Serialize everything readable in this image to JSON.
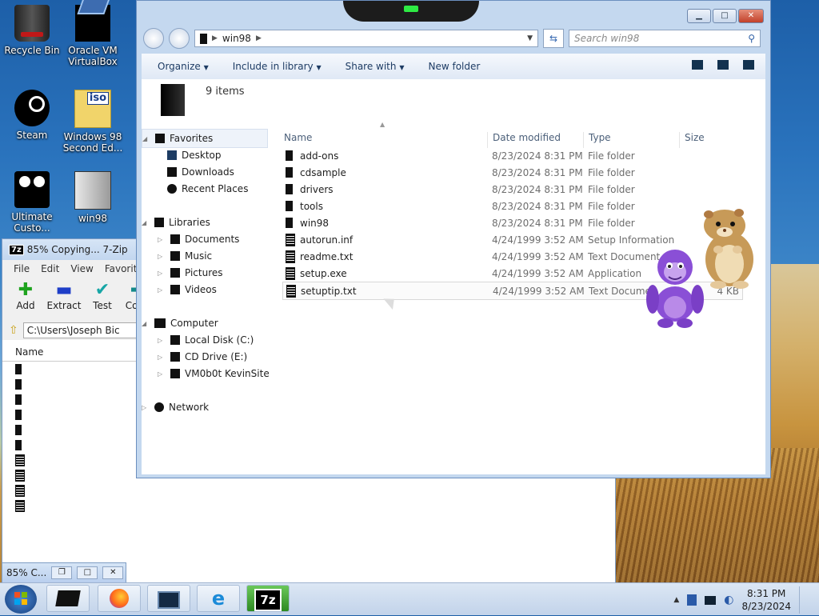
{
  "desktop": {
    "icons": [
      {
        "label": "Recycle Bin",
        "icon": "recycle-bin-icon"
      },
      {
        "label": "Oracle VM VirtualBox",
        "icon": "virtualbox-icon"
      },
      {
        "label": "Steam",
        "icon": "steam-icon"
      },
      {
        "label": "Windows 98 Second Ed...",
        "icon": "iso-file-icon"
      },
      {
        "label": "Ultimate Custo...",
        "icon": "film-reel-icon"
      },
      {
        "label": "win98",
        "icon": "document-icon"
      }
    ]
  },
  "zip": {
    "title": "85% Copying... 7-Zip",
    "menu": [
      "File",
      "Edit",
      "View",
      "Favorites"
    ],
    "tools": [
      "Add",
      "Extract",
      "Test",
      "Copy"
    ],
    "path": "C:\\Users\\Joseph Bic",
    "column_name": "Name",
    "progress_title": "85% C..."
  },
  "explorer": {
    "address": [
      "win98"
    ],
    "search_placeholder": "Search win98",
    "commands": [
      "Organize",
      "Include in library",
      "Share with",
      "New folder"
    ],
    "item_count": "9 items",
    "nav": {
      "favorites": "Favorites",
      "desktop": "Desktop",
      "downloads": "Downloads",
      "recent": "Recent Places",
      "libraries": "Libraries",
      "documents": "Documents",
      "music": "Music",
      "pictures": "Pictures",
      "videos": "Videos",
      "computer": "Computer",
      "local_disk": "Local Disk (C:)",
      "cd_drive": "CD Drive (E:)",
      "vm_drive": "VM0b0t KevinSite",
      "network": "Network"
    },
    "columns": {
      "name": "Name",
      "date": "Date modified",
      "type": "Type",
      "size": "Size"
    },
    "files": [
      {
        "name": "add-ons",
        "date": "8/23/2024 8:31 PM",
        "type": "File folder",
        "size": "",
        "kind": "folder"
      },
      {
        "name": "cdsample",
        "date": "8/23/2024 8:31 PM",
        "type": "File folder",
        "size": "",
        "kind": "folder"
      },
      {
        "name": "drivers",
        "date": "8/23/2024 8:31 PM",
        "type": "File folder",
        "size": "",
        "kind": "folder"
      },
      {
        "name": "tools",
        "date": "8/23/2024 8:31 PM",
        "type": "File folder",
        "size": "",
        "kind": "folder"
      },
      {
        "name": "win98",
        "date": "8/23/2024 8:31 PM",
        "type": "File folder",
        "size": "",
        "kind": "folder"
      },
      {
        "name": "autorun.inf",
        "date": "4/24/1999 3:52 AM",
        "type": "Setup Information",
        "size": "",
        "kind": "doc"
      },
      {
        "name": "readme.txt",
        "date": "4/24/1999 3:52 AM",
        "type": "Text Document",
        "size": "",
        "kind": "doc"
      },
      {
        "name": "setup.exe",
        "date": "4/24/1999 3:52 AM",
        "type": "Application",
        "size": "",
        "kind": "doc"
      },
      {
        "name": "setuptip.txt",
        "date": "4/24/1999 3:52 AM",
        "type": "Text Documen",
        "size": "4 KB",
        "kind": "doc"
      }
    ]
  },
  "taskbar": {
    "time": "8:31 PM",
    "date": "8/23/2024"
  }
}
